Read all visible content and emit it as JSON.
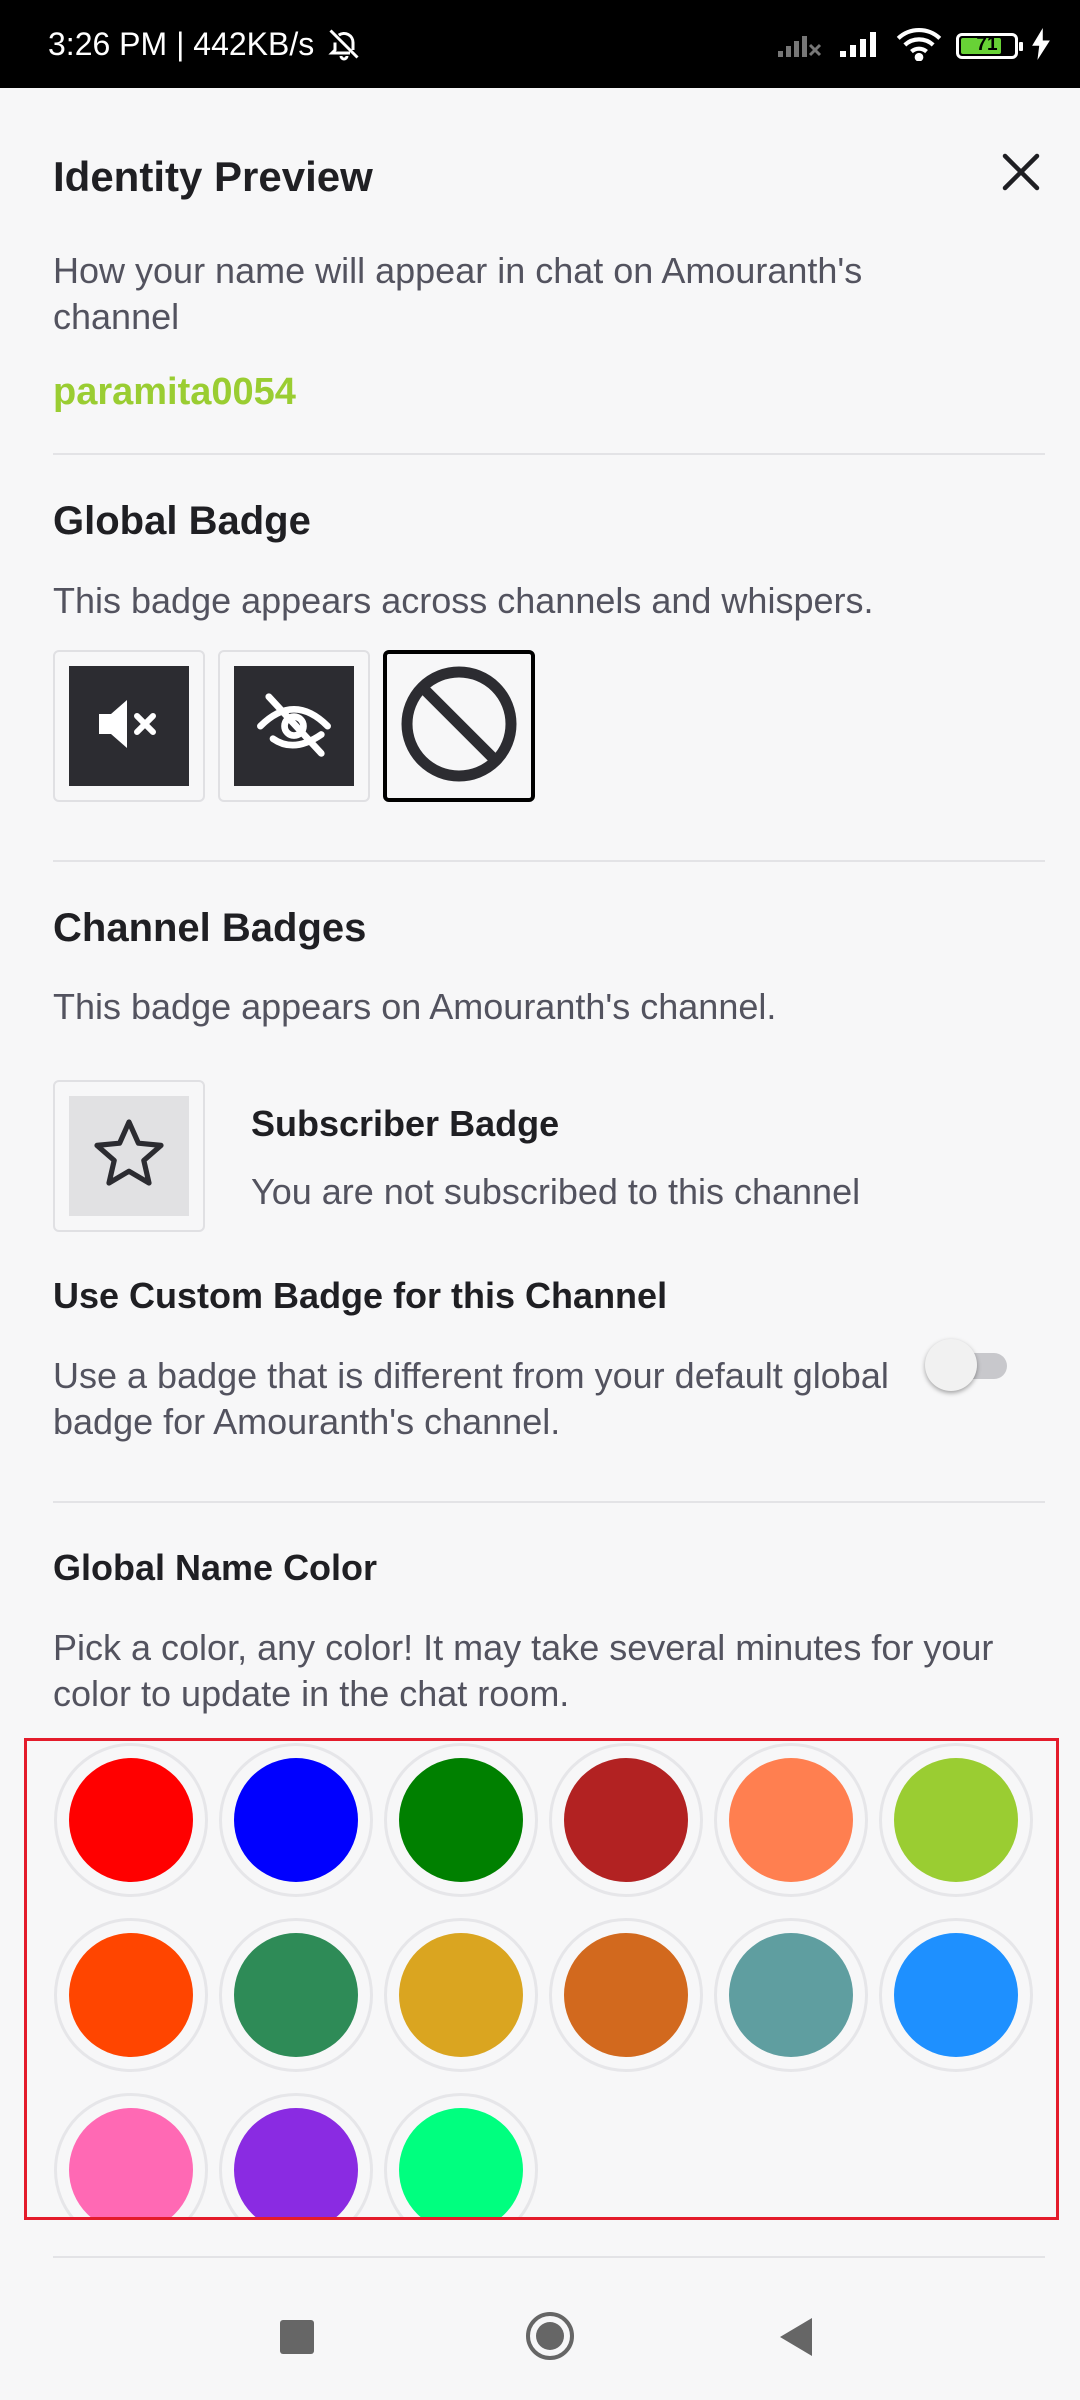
{
  "status": {
    "time_speed": "3:26 PM | 442KB/s",
    "battery_level": "71"
  },
  "dialog": {
    "title": "Identity Preview",
    "description": "How your name will appear in chat on Amouranth's channel",
    "username": "paramita0054",
    "username_color": "#9acd32"
  },
  "global_badge": {
    "heading": "Global Badge",
    "description": "This badge appears across channels and whispers.",
    "badges": [
      {
        "icon": "muted-speaker-icon"
      },
      {
        "icon": "hidden-eye-icon"
      },
      {
        "icon": "no-badge-icon",
        "selected": true
      }
    ]
  },
  "channel_badges": {
    "heading": "Channel Badges",
    "description": "This badge appears on Amouranth's channel.",
    "subscriber_title": "Subscriber Badge",
    "subscriber_desc": "You are not subscribed to this channel",
    "custom_heading": "Use Custom Badge for this Channel",
    "custom_desc": "Use a badge that is different from your default global badge for Amouranth's channel.",
    "custom_enabled": false
  },
  "name_color": {
    "heading": "Global Name Color",
    "description": "Pick a color, any color! It may take several minutes for your color to update in the chat room.",
    "colors": [
      "#ff0000",
      "#0000ff",
      "#008000",
      "#b22222",
      "#ff7f50",
      "#9acd32",
      "#ff4500",
      "#2e8b57",
      "#daa520",
      "#d2691e",
      "#5f9ea0",
      "#1e90ff",
      "#ff69b4",
      "#8a2be2",
      "#00ff7f"
    ]
  }
}
